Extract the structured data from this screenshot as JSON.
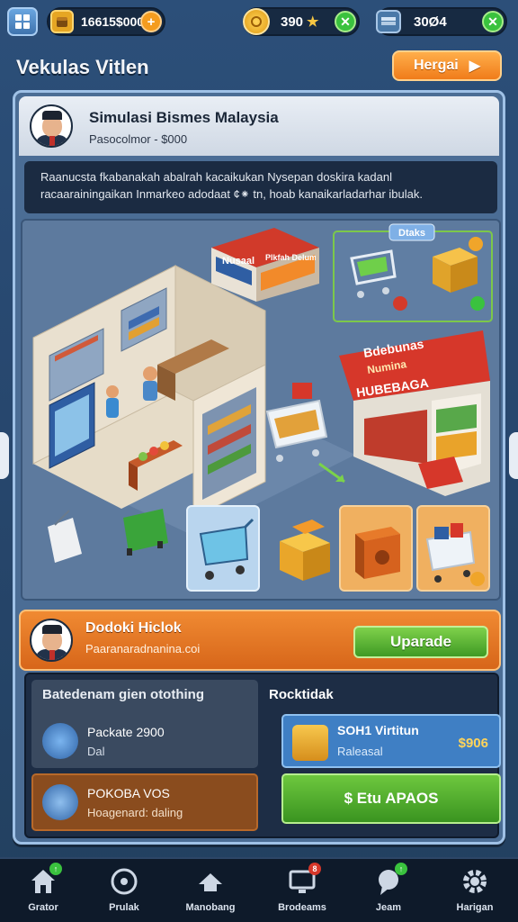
{
  "topbar": {
    "coins_value": "16615$000",
    "gems_value": "390",
    "cash_value": "30Ø4",
    "colors": {
      "coin": "#f4b531",
      "plus": "#f49c1f",
      "green": "#3ac23e"
    }
  },
  "header": {
    "title": "Vekulas Vitlen",
    "hire_label": "Hergai"
  },
  "main_panel": {
    "title": "Simulasi Bismes Malaysia",
    "subtitle": "Pasocolmor - $000",
    "description": "Raanucsta fkabanakah abalrah kacaikukan Nysepan doskira kadanl racaarainingaikan Inmarkeo adodaat ¢⁕ tn, hoab kanaikarladarhar ibulak."
  },
  "scene": {
    "shop_sign": "Nusaal",
    "stand_sign": "Plkfah Deluma",
    "tag_label": "Dtaks",
    "market_banner_1": "Bdebunas",
    "market_banner_2": "Numina",
    "market_banner_3": "HUBEBAGA"
  },
  "upgrade": {
    "title": "Dodoki Hiclok",
    "subtitle": "Paaranaradnanina.coi",
    "button_label": "Uparade"
  },
  "lower": {
    "left_heading": "Batedenam gien otothing",
    "right_heading": "Rocktidak",
    "card1": {
      "title": "Packate 2900",
      "sub": "Dal"
    },
    "card2": {
      "title": "POKOBA VOS",
      "sub": "Hoagenard: daling"
    },
    "card3": {
      "title": "SOH1 Virtitun",
      "sub": "Raleasal",
      "value": "$906"
    },
    "card4": {
      "label": "$ Etu APAOS"
    }
  },
  "nav": {
    "items": [
      {
        "label": "Grator",
        "icon": "home-icon",
        "badge": ""
      },
      {
        "label": "Prulak",
        "icon": "target-icon",
        "badge": ""
      },
      {
        "label": "Manobang",
        "icon": "hat-icon",
        "badge": ""
      },
      {
        "label": "Brodeams",
        "icon": "monitor-icon",
        "badge": "8"
      },
      {
        "label": "Jeam",
        "icon": "chat-icon",
        "badge": ""
      },
      {
        "label": "Harigan",
        "icon": "gear-icon",
        "badge": ""
      }
    ]
  }
}
